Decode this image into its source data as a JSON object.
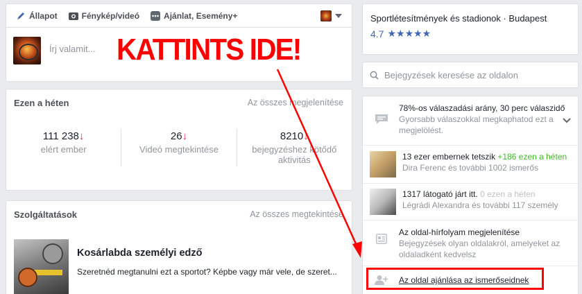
{
  "composer": {
    "tabs": [
      {
        "label": "Állapot",
        "icon": "pencil-icon"
      },
      {
        "label": "Fénykép/videó",
        "icon": "camera-icon"
      },
      {
        "label": "Ajánlat, Esemény+",
        "icon": "more-icon"
      }
    ],
    "placeholder": "Írj valamit..."
  },
  "stats": {
    "title": "Ezen a héten",
    "see_all": "Az összes megjelenítése",
    "items": [
      {
        "value": "111 238",
        "label": "elért ember"
      },
      {
        "value": "26",
        "label": "Videó megtekintése"
      },
      {
        "value": "8210",
        "label": "bejegyzéshez kötődő aktivitás"
      }
    ],
    "down_arrow": "↓"
  },
  "services": {
    "title": "Szolgáltatások",
    "see_all": "Az összes megtekintése",
    "item": {
      "title": "Kosárlabda személyi edző",
      "description": "Szeretnéd megtanulni ezt a sportot? Képbe vagy már vele, de szeret..."
    }
  },
  "rating_card": {
    "category": "Sportlétesítmények és stadionok · Budapest",
    "rating": "4.7",
    "stars": "★★★★★"
  },
  "search": {
    "placeholder": "Bejegyzések keresése az oldalon"
  },
  "info": {
    "response": {
      "main": "78%-os válaszadási arány, 30 perc válaszidő",
      "sub": "Gyorsabb válaszokkal megkaphatod ezt a megjelölést."
    },
    "likes": {
      "main": "13 ezer embernek tetszik",
      "delta": "+186 ezen a héten",
      "sub": "Dira Ferenc és további 1002 ismerős"
    },
    "visits": {
      "main": "1317 látogató járt itt.",
      "delta": "0 ezen a héten",
      "sub": "Légrádi Alexandra és további 117 személy"
    },
    "feed": {
      "main": "Az oldal-hírfolyam megjelenítése",
      "sub": "Bejegyzések olyan oldalakról, amelyeket az oldaladként kedvelsz"
    },
    "recommend": {
      "main": "Az oldal ajánlása az ismerőseidnek"
    }
  },
  "overlay": {
    "text": "KATTINTS IDE!",
    "color": "#ff0000"
  }
}
